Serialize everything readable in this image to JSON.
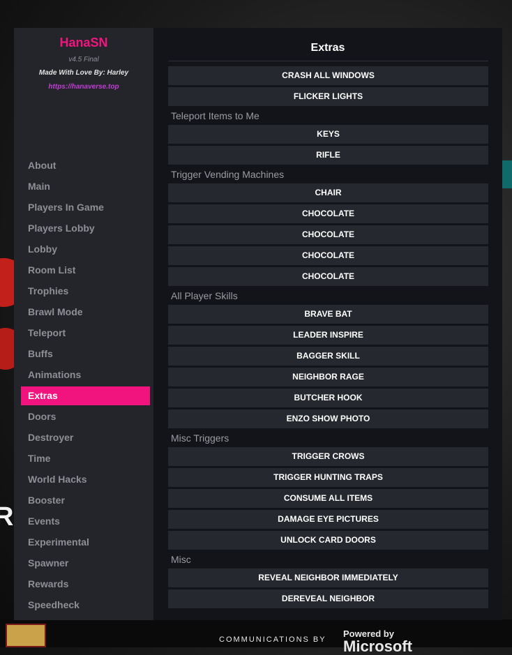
{
  "brand": {
    "title": "HanaSN",
    "version": "v4.5 Final",
    "credit": "Made With Love By: Harley",
    "link": "https://hanaverse.top"
  },
  "nav": {
    "items": [
      {
        "label": "About",
        "active": false
      },
      {
        "label": "Main",
        "active": false
      },
      {
        "label": "Players In Game",
        "active": false
      },
      {
        "label": "Players Lobby",
        "active": false
      },
      {
        "label": "Lobby",
        "active": false
      },
      {
        "label": "Room List",
        "active": false
      },
      {
        "label": "Trophies",
        "active": false
      },
      {
        "label": "Brawl Mode",
        "active": false
      },
      {
        "label": "Teleport",
        "active": false
      },
      {
        "label": "Buffs",
        "active": false
      },
      {
        "label": "Animations",
        "active": false
      },
      {
        "label": "Extras",
        "active": true
      },
      {
        "label": "Doors",
        "active": false
      },
      {
        "label": "Destroyer",
        "active": false
      },
      {
        "label": "Time",
        "active": false
      },
      {
        "label": "World Hacks",
        "active": false
      },
      {
        "label": "Booster",
        "active": false
      },
      {
        "label": "Events",
        "active": false
      },
      {
        "label": "Experimental",
        "active": false
      },
      {
        "label": "Spawner",
        "active": false
      },
      {
        "label": "Rewards",
        "active": false
      },
      {
        "label": "Speedheck",
        "active": false
      }
    ]
  },
  "content": {
    "title": "Extras",
    "rows": [
      {
        "type": "button",
        "label": "CRASH ALL WINDOWS"
      },
      {
        "type": "button",
        "label": "FLICKER LIGHTS"
      },
      {
        "type": "section",
        "label": "Teleport Items to Me"
      },
      {
        "type": "button",
        "label": "KEYS"
      },
      {
        "type": "button",
        "label": "RIFLE"
      },
      {
        "type": "section",
        "label": "Trigger Vending Machines"
      },
      {
        "type": "button",
        "label": "CHAIR"
      },
      {
        "type": "button",
        "label": "CHOCOLATE"
      },
      {
        "type": "button",
        "label": "CHOCOLATE"
      },
      {
        "type": "button",
        "label": "CHOCOLATE"
      },
      {
        "type": "button",
        "label": "CHOCOLATE"
      },
      {
        "type": "section",
        "label": "All Player Skills"
      },
      {
        "type": "button",
        "label": "BRAVE BAT"
      },
      {
        "type": "button",
        "label": "LEADER INSPIRE"
      },
      {
        "type": "button",
        "label": "BAGGER SKILL"
      },
      {
        "type": "button",
        "label": "NEIGHBOR RAGE"
      },
      {
        "type": "button",
        "label": "BUTCHER HOOK"
      },
      {
        "type": "button",
        "label": "ENZO SHOW PHOTO"
      },
      {
        "type": "section",
        "label": "Misc Triggers"
      },
      {
        "type": "button",
        "label": "TRIGGER CROWS"
      },
      {
        "type": "button",
        "label": "TRIGGER HUNTING TRAPS"
      },
      {
        "type": "button",
        "label": "CONSUME ALL ITEMS"
      },
      {
        "type": "button",
        "label": "DAMAGE EYE PICTURES"
      },
      {
        "type": "button",
        "label": "UNLOCK CARD DOORS"
      },
      {
        "type": "section",
        "label": "Misc"
      },
      {
        "type": "button",
        "label": "REVEAL NEIGHBOR IMMEDIATELY"
      },
      {
        "type": "button",
        "label": "DEREVEAL NEIGHBOR"
      }
    ]
  },
  "footer": {
    "communications": "COMMUNICATIONS BY",
    "powered": "Powered by",
    "microsoft": "Microsoft"
  },
  "colors": {
    "accent": "#f2147e",
    "sidebar_bg": "#23252b",
    "content_bg": "#13141a",
    "button_bg": "#262830",
    "link": "#c03ed2"
  }
}
